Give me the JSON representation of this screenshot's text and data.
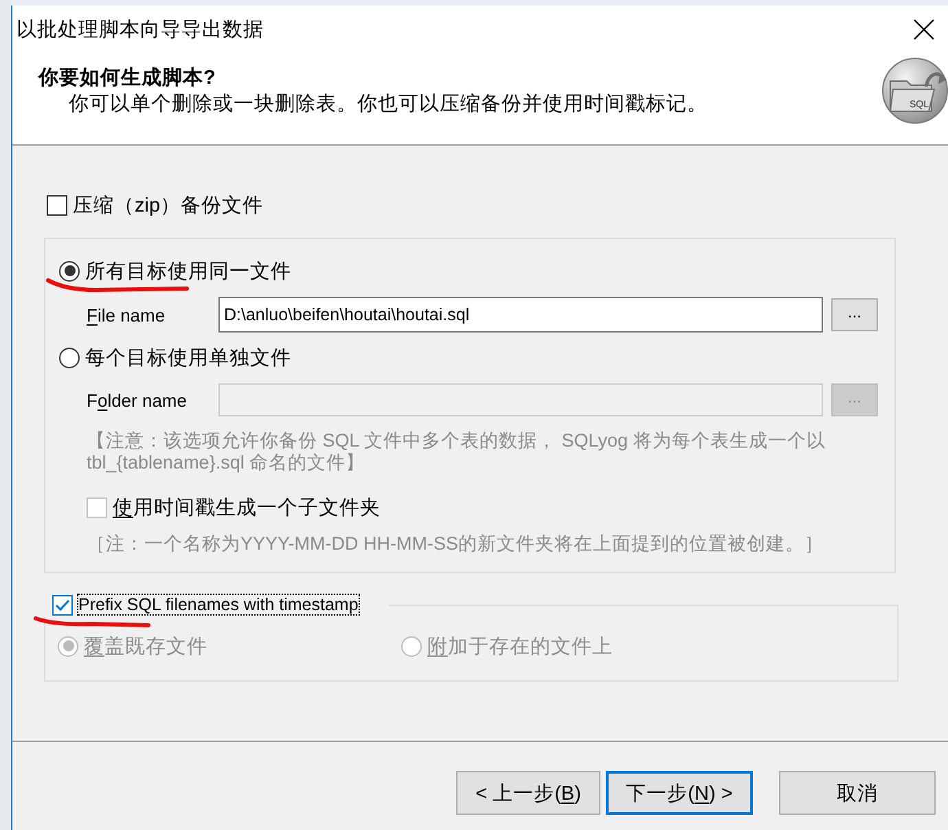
{
  "window": {
    "title": "以批处理脚本向导导出数据"
  },
  "header": {
    "title": "你要如何生成脚本?",
    "subtitle": "你可以单个删除或一块删除表。你也可以压缩备份并使用时间戳标记。",
    "icon_text": "SQL"
  },
  "zip_option": {
    "label": "压缩（zip）备份文件",
    "checked": false
  },
  "output_mode": {
    "options": [
      {
        "label": "所有目标使用同一文件",
        "selected": true,
        "field": {
          "label": [
            {
              "text": "F",
              "underlined": true
            },
            {
              "text": "ile name",
              "underlined": false
            }
          ],
          "value": "D:\\anluo\\beifen\\houtai\\houtai.sql",
          "button": "...",
          "disabled": false
        }
      },
      {
        "label": "每个目标使用单独文件",
        "selected": false,
        "field": {
          "label": [
            {
              "text": "F",
              "underlined": false
            },
            {
              "text": "o",
              "underlined": true
            },
            {
              "text": "lder name",
              "underlined": false
            }
          ],
          "button": "...",
          "disabled": true
        }
      }
    ],
    "note": "【注意：该选项允许你备份 SQL 文件中多个表的数据， SQLyog 将为每个表生成一个以 tbl_{tablename}.sql 命名的文件】",
    "subfolder": {
      "label": [
        {
          "text": "使",
          "underlined": true
        },
        {
          "text": "用时间戳生成一个子文件夹",
          "underlined": false
        }
      ],
      "checked": false,
      "disabled": true
    },
    "subfolder_note": "［注：一个名称为YYYY-MM-DD HH-MM-SS的新文件夹将在上面提到的位置被创建。］"
  },
  "prefix_timestamp": {
    "label": "Prefix SQL filenames with timestamp",
    "checked": true,
    "focused": true
  },
  "existing_file": {
    "options": [
      {
        "label": [
          {
            "text": "覆",
            "underlined": true
          },
          {
            "text": "盖既存文件",
            "underlined": false
          }
        ],
        "selected": true,
        "disabled": true
      },
      {
        "label": [
          {
            "text": "附",
            "underlined": true
          },
          {
            "text": "加于存在的文件上",
            "underlined": false
          }
        ],
        "selected": false,
        "disabled": true
      }
    ]
  },
  "buttons": [
    {
      "kind": "back",
      "label": [
        {
          "text": "< 上一步(",
          "underlined": false
        },
        {
          "text": "B",
          "underlined": true
        },
        {
          "text": ")",
          "underlined": false
        }
      ],
      "default": false
    },
    {
      "kind": "next",
      "label": [
        {
          "text": "下一步(",
          "underlined": false
        },
        {
          "text": "N",
          "underlined": true
        },
        {
          "text": ") >",
          "underlined": false
        }
      ],
      "default": true
    },
    {
      "kind": "cancel",
      "label": [
        {
          "text": "取消",
          "underlined": false
        }
      ],
      "default": false
    }
  ]
}
